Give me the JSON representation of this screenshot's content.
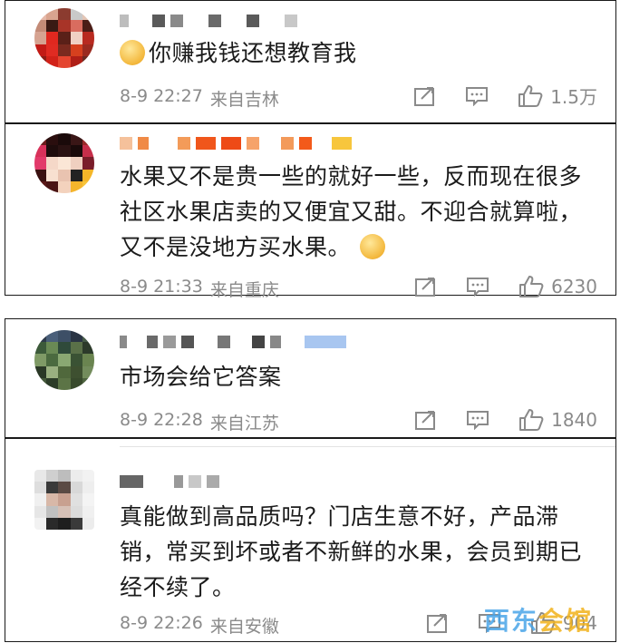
{
  "comments": [
    {
      "text": "你赚我钱还想教育我",
      "has_leading_emoji": true,
      "date": "8-9 22:27",
      "location": "来自吉林",
      "likes": "1.5万"
    },
    {
      "text": "水果又不是贵一些的就好一些，反而现在很多社区水果店卖的又便宜又甜。不迎合就算啦，又不是没地方买水果。",
      "has_trailing_emoji": true,
      "date": "8-9 21:33",
      "location": "来自重庆",
      "likes": "6230"
    },
    {
      "text": "市场会给它答案",
      "date": "8-9 22:28",
      "location": "来自江苏",
      "likes": "1840"
    },
    {
      "text": "真能做到高品质吗？门店生意不好，产品滞销，常买到坏或者不新鲜的水果，会员到期已经不续了。",
      "date": "8-9 22:26",
      "location": "来自安徽",
      "likes": "904"
    }
  ],
  "icons": {
    "share": "share-icon",
    "comment": "comment-icon",
    "like": "thumbs-up-icon"
  },
  "watermark": {
    "part1": "西",
    "part2": "东",
    "part3": "会馆"
  }
}
